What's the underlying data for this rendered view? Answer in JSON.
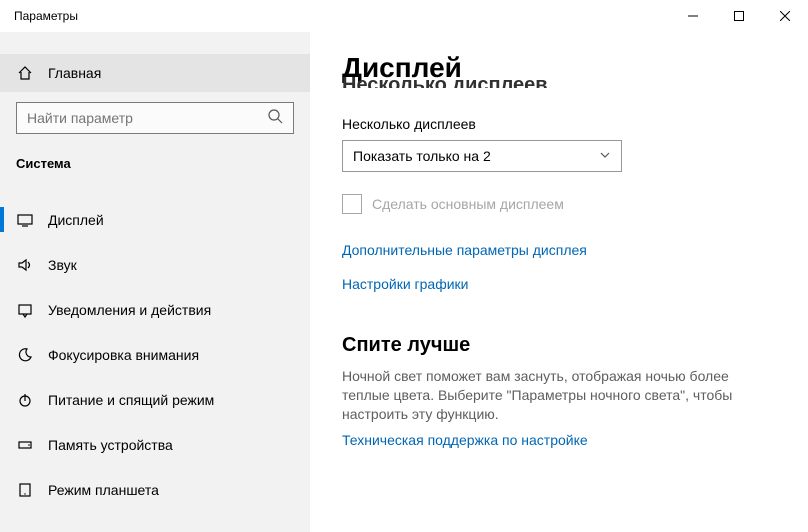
{
  "window": {
    "title": "Параметры"
  },
  "sidebar": {
    "home_label": "Главная",
    "search_placeholder": "Найти параметр",
    "section_label": "Система",
    "items": [
      {
        "label": "Дисплей"
      },
      {
        "label": "Звук"
      },
      {
        "label": "Уведомления и действия"
      },
      {
        "label": "Фокусировка внимания"
      },
      {
        "label": "Питание и спящий режим"
      },
      {
        "label": "Память устройства"
      },
      {
        "label": "Режим планшета"
      }
    ]
  },
  "main": {
    "title": "Дисплей",
    "truncated_header": "Несколько дисплеев",
    "sub_label": "Несколько дисплеев",
    "dropdown_value": "Показать только на 2",
    "checkbox_label": "Сделать основным дисплеем",
    "link_advanced": "Дополнительные параметры дисплея",
    "link_graphics": "Настройки графики",
    "sleep_header": "Спите лучше",
    "sleep_body": "Ночной свет поможет вам заснуть, отображая ночью более теплые цвета. Выберите \"Параметры ночного света\", чтобы настроить эту функцию.",
    "link_support": "Техническая поддержка по настройке"
  }
}
